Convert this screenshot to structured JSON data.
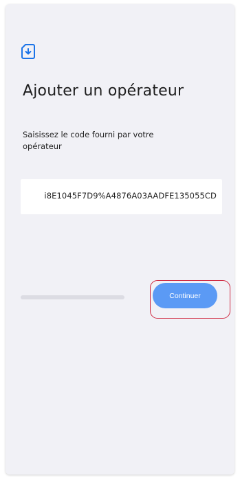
{
  "screen": {
    "icon": "sim-card-download-icon",
    "title": "Ajouter un opérateur",
    "instruction": "Saisissez le code fourni par votre opérateur",
    "code_field": {
      "value": "i8E1045F7D9%A4876A03AADFE135055CD"
    },
    "progress": {
      "fraction": 0.0
    },
    "continue_label": "Continuer"
  },
  "colors": {
    "background": "#f1f1f6",
    "accent": "#5b9af5",
    "highlight": "#cf2a42"
  }
}
